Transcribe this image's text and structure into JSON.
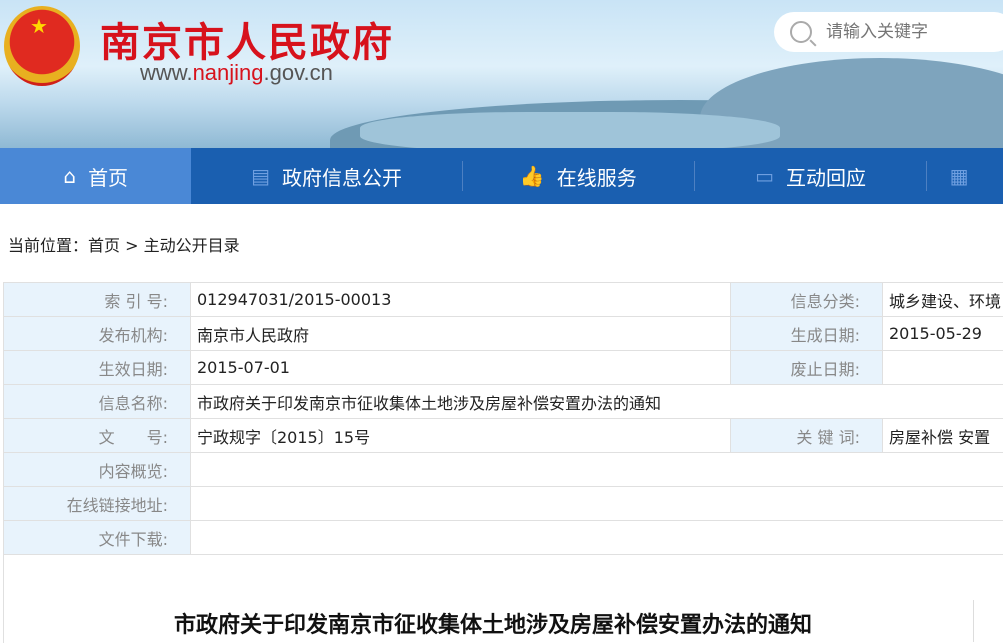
{
  "header": {
    "site_name": "南京市人民政府",
    "url_prefix": "www.",
    "url_main": "nanjing",
    "url_suffix": ".gov.cn",
    "search_placeholder": "请输入关键字"
  },
  "nav": [
    {
      "label": "首页",
      "icon": "home-icon"
    },
    {
      "label": "政府信息公开",
      "icon": "newspaper-icon"
    },
    {
      "label": "在线服务",
      "icon": "thumbs-up-icon"
    },
    {
      "label": "互动回应",
      "icon": "chat-icon"
    }
  ],
  "breadcrumb": {
    "prefix": "当前位置：",
    "home": "首页",
    "sep": " > ",
    "current": "主动公开目录"
  },
  "info": {
    "index_label": "索 引 号:",
    "index": "012947031/2015-00013",
    "category_label": "信息分类:",
    "category": "城乡建设、环境",
    "publisher_label": "发布机构:",
    "publisher": "南京市人民政府",
    "created_label": "生成日期:",
    "created": "2015-05-29",
    "effective_label": "生效日期:",
    "effective": "2015-07-01",
    "repealed_label": "废止日期:",
    "repealed": "",
    "name_label": "信息名称:",
    "name": "市政府关于印发南京市征收集体土地涉及房屋补偿安置办法的通知",
    "docno_label": "文　　号:",
    "docno": "宁政规字〔2015〕15号",
    "keywords_label": "关 键 词:",
    "keywords": "房屋补偿 安置",
    "summary_label": "内容概览:",
    "link_label": "在线链接地址:",
    "download_label": "文件下载:"
  },
  "doc_title": "市政府关于印发南京市征收集体土地涉及房屋补偿安置办法的通知",
  "colors": {
    "nav": "#1a5fb0",
    "nav_active": "#4a88d6",
    "brand_red": "#d7121c",
    "label_bg": "#e8f3fc"
  }
}
